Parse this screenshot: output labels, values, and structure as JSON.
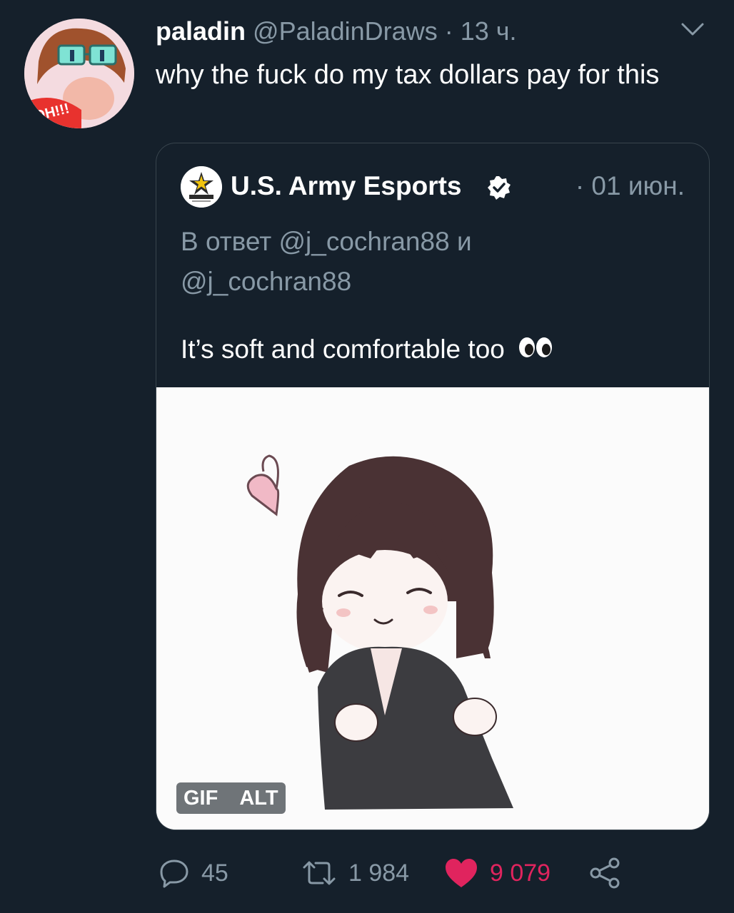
{
  "tweet": {
    "author_name": "paladin",
    "author_handle": "@PaladinDraws",
    "separator": "·",
    "time": "13 ч.",
    "text": "why the fuck do my tax dollars pay for this",
    "menu_icon": "chevron-down-icon"
  },
  "quoted": {
    "author_name": "U.S. Army Esports",
    "verified_icon": "verified-badge-icon",
    "date": "· 01 июн.",
    "reply_prefix": "В ответ",
    "reply_user1": "@j_cochran88",
    "reply_and": "и",
    "reply_user2": "@j_cochran88",
    "text": "It’s soft and comfortable too",
    "emoji": "eyes-emoji",
    "media_badges": {
      "gif": "GIF",
      "alt": "ALT"
    }
  },
  "actions": {
    "replies": "45",
    "retweets": "1 984",
    "likes": "9 079",
    "like_color": "#e0245e",
    "muted_color": "#8899a6"
  }
}
